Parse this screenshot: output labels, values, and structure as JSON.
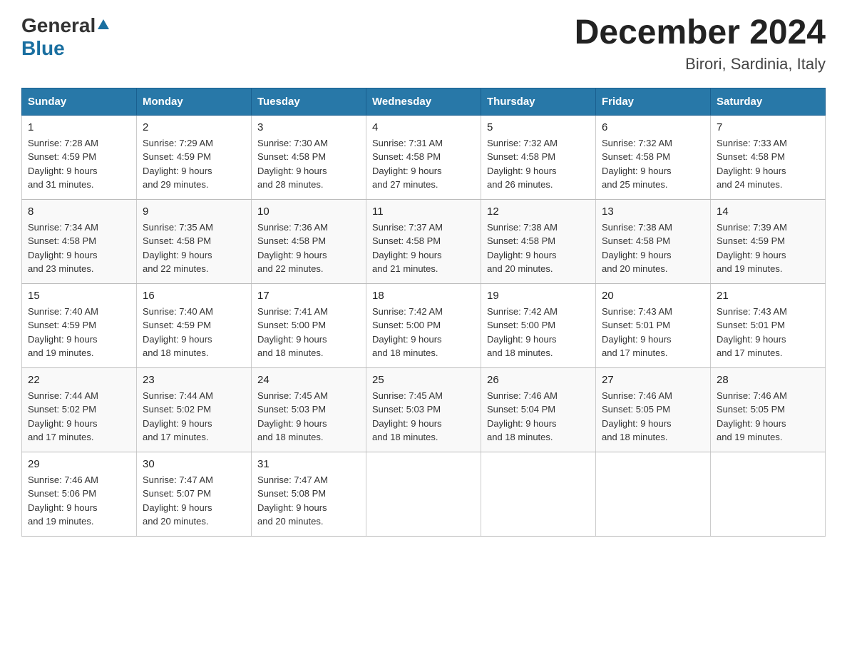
{
  "header": {
    "logo_general": "General",
    "logo_blue": "Blue",
    "month_title": "December 2024",
    "location": "Birori, Sardinia, Italy"
  },
  "weekdays": [
    "Sunday",
    "Monday",
    "Tuesday",
    "Wednesday",
    "Thursday",
    "Friday",
    "Saturday"
  ],
  "weeks": [
    [
      {
        "day": "1",
        "sunrise": "7:28 AM",
        "sunset": "4:59 PM",
        "daylight": "9 hours and 31 minutes."
      },
      {
        "day": "2",
        "sunrise": "7:29 AM",
        "sunset": "4:59 PM",
        "daylight": "9 hours and 29 minutes."
      },
      {
        "day": "3",
        "sunrise": "7:30 AM",
        "sunset": "4:58 PM",
        "daylight": "9 hours and 28 minutes."
      },
      {
        "day": "4",
        "sunrise": "7:31 AM",
        "sunset": "4:58 PM",
        "daylight": "9 hours and 27 minutes."
      },
      {
        "day": "5",
        "sunrise": "7:32 AM",
        "sunset": "4:58 PM",
        "daylight": "9 hours and 26 minutes."
      },
      {
        "day": "6",
        "sunrise": "7:32 AM",
        "sunset": "4:58 PM",
        "daylight": "9 hours and 25 minutes."
      },
      {
        "day": "7",
        "sunrise": "7:33 AM",
        "sunset": "4:58 PM",
        "daylight": "9 hours and 24 minutes."
      }
    ],
    [
      {
        "day": "8",
        "sunrise": "7:34 AM",
        "sunset": "4:58 PM",
        "daylight": "9 hours and 23 minutes."
      },
      {
        "day": "9",
        "sunrise": "7:35 AM",
        "sunset": "4:58 PM",
        "daylight": "9 hours and 22 minutes."
      },
      {
        "day": "10",
        "sunrise": "7:36 AM",
        "sunset": "4:58 PM",
        "daylight": "9 hours and 22 minutes."
      },
      {
        "day": "11",
        "sunrise": "7:37 AM",
        "sunset": "4:58 PM",
        "daylight": "9 hours and 21 minutes."
      },
      {
        "day": "12",
        "sunrise": "7:38 AM",
        "sunset": "4:58 PM",
        "daylight": "9 hours and 20 minutes."
      },
      {
        "day": "13",
        "sunrise": "7:38 AM",
        "sunset": "4:58 PM",
        "daylight": "9 hours and 20 minutes."
      },
      {
        "day": "14",
        "sunrise": "7:39 AM",
        "sunset": "4:59 PM",
        "daylight": "9 hours and 19 minutes."
      }
    ],
    [
      {
        "day": "15",
        "sunrise": "7:40 AM",
        "sunset": "4:59 PM",
        "daylight": "9 hours and 19 minutes."
      },
      {
        "day": "16",
        "sunrise": "7:40 AM",
        "sunset": "4:59 PM",
        "daylight": "9 hours and 18 minutes."
      },
      {
        "day": "17",
        "sunrise": "7:41 AM",
        "sunset": "5:00 PM",
        "daylight": "9 hours and 18 minutes."
      },
      {
        "day": "18",
        "sunrise": "7:42 AM",
        "sunset": "5:00 PM",
        "daylight": "9 hours and 18 minutes."
      },
      {
        "day": "19",
        "sunrise": "7:42 AM",
        "sunset": "5:00 PM",
        "daylight": "9 hours and 18 minutes."
      },
      {
        "day": "20",
        "sunrise": "7:43 AM",
        "sunset": "5:01 PM",
        "daylight": "9 hours and 17 minutes."
      },
      {
        "day": "21",
        "sunrise": "7:43 AM",
        "sunset": "5:01 PM",
        "daylight": "9 hours and 17 minutes."
      }
    ],
    [
      {
        "day": "22",
        "sunrise": "7:44 AM",
        "sunset": "5:02 PM",
        "daylight": "9 hours and 17 minutes."
      },
      {
        "day": "23",
        "sunrise": "7:44 AM",
        "sunset": "5:02 PM",
        "daylight": "9 hours and 17 minutes."
      },
      {
        "day": "24",
        "sunrise": "7:45 AM",
        "sunset": "5:03 PM",
        "daylight": "9 hours and 18 minutes."
      },
      {
        "day": "25",
        "sunrise": "7:45 AM",
        "sunset": "5:03 PM",
        "daylight": "9 hours and 18 minutes."
      },
      {
        "day": "26",
        "sunrise": "7:46 AM",
        "sunset": "5:04 PM",
        "daylight": "9 hours and 18 minutes."
      },
      {
        "day": "27",
        "sunrise": "7:46 AM",
        "sunset": "5:05 PM",
        "daylight": "9 hours and 18 minutes."
      },
      {
        "day": "28",
        "sunrise": "7:46 AM",
        "sunset": "5:05 PM",
        "daylight": "9 hours and 19 minutes."
      }
    ],
    [
      {
        "day": "29",
        "sunrise": "7:46 AM",
        "sunset": "5:06 PM",
        "daylight": "9 hours and 19 minutes."
      },
      {
        "day": "30",
        "sunrise": "7:47 AM",
        "sunset": "5:07 PM",
        "daylight": "9 hours and 20 minutes."
      },
      {
        "day": "31",
        "sunrise": "7:47 AM",
        "sunset": "5:08 PM",
        "daylight": "9 hours and 20 minutes."
      },
      null,
      null,
      null,
      null
    ]
  ],
  "labels": {
    "sunrise": "Sunrise:",
    "sunset": "Sunset:",
    "daylight": "Daylight:"
  }
}
